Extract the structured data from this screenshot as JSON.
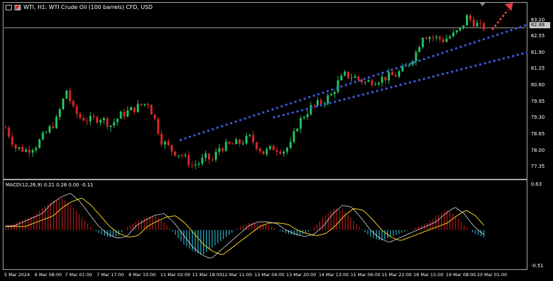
{
  "chart": {
    "title": "WTI, H1:  WTI Crude Oil (100 barrels) CFD, USD",
    "current_price": "82.88",
    "y_ticks": [
      "83.20",
      "82.55",
      "81.90",
      "81.25",
      "80.60",
      "79.95",
      "79.30",
      "78.65",
      "78.00",
      "77.35"
    ],
    "x_ticks": [
      "5 Mar 2024",
      "6 Mar 08:00",
      "7 Mar 01:00",
      "7 Mar 17:00",
      "8 Mar 10:00",
      "11 Mar 02:00",
      "11 Mar 18:00",
      "12 Mar 11:00",
      "13 Mar 04:00",
      "13 Mar 20:00",
      "14 Mar 13:00",
      "15 Mar 06:00",
      "15 Mar 22:00",
      "18 Mar 15:00",
      "19 Mar 08:00",
      "20 Mar 01:00"
    ]
  },
  "indicator": {
    "title": "MACD(12,26,9) 0.21 0.26 0.00 -0.11",
    "y_ticks": [
      "0.63",
      "-0.51"
    ]
  },
  "colors": {
    "background": "#000000",
    "bull": "#22c55e",
    "bear": "#dc2626",
    "trendline": "#3b5bdb",
    "arrow": "#e23b4a",
    "macd_pos": "#b91c1c",
    "macd_neg": "#22b8cf",
    "signal": "#f5d020",
    "macd_line": "#ffffff"
  },
  "chart_data": {
    "type": "candlestick",
    "symbol": "WTI",
    "timeframe": "H1",
    "ylim": [
      77.0,
      83.6
    ],
    "close_path": [
      [
        0,
        78.9
      ],
      [
        3,
        78.1
      ],
      [
        6,
        78.0
      ],
      [
        9,
        78.2
      ],
      [
        12,
        78.7
      ],
      [
        15,
        79.2
      ],
      [
        18,
        80.4
      ],
      [
        20,
        79.6
      ],
      [
        22,
        79.3
      ],
      [
        25,
        79.2
      ],
      [
        28,
        79.3
      ],
      [
        31,
        79.0
      ],
      [
        34,
        79.4
      ],
      [
        37,
        79.6
      ],
      [
        40,
        79.8
      ],
      [
        42,
        79.9
      ],
      [
        44,
        79.2
      ],
      [
        46,
        78.4
      ],
      [
        49,
        78.0
      ],
      [
        52,
        77.8
      ],
      [
        55,
        77.4
      ],
      [
        57,
        77.5
      ],
      [
        59,
        77.7
      ],
      [
        61,
        77.6
      ],
      [
        63,
        78.1
      ],
      [
        66,
        78.2
      ],
      [
        69,
        78.3
      ],
      [
        72,
        78.5
      ],
      [
        74,
        78.2
      ],
      [
        76,
        77.9
      ],
      [
        79,
        78.1
      ],
      [
        82,
        78.0
      ],
      [
        84,
        78.2
      ],
      [
        86,
        79.0
      ],
      [
        88,
        79.4
      ],
      [
        90,
        79.7
      ],
      [
        93,
        79.9
      ],
      [
        96,
        80.2
      ],
      [
        98,
        80.7
      ],
      [
        100,
        81.0
      ],
      [
        103,
        80.9
      ],
      [
        106,
        80.7
      ],
      [
        109,
        80.8
      ],
      [
        112,
        80.9
      ],
      [
        115,
        81.0
      ],
      [
        118,
        81.3
      ],
      [
        121,
        81.9
      ],
      [
        123,
        82.6
      ],
      [
        126,
        82.5
      ],
      [
        129,
        82.4
      ],
      [
        132,
        82.6
      ],
      [
        134,
        82.8
      ],
      [
        136,
        83.3
      ],
      [
        138,
        83.1
      ],
      [
        140,
        82.9
      ],
      [
        141,
        82.9
      ]
    ],
    "macd_hist": [
      0.05,
      0.1,
      0.15,
      0.2,
      0.32,
      0.4,
      0.45,
      0.35,
      0.2,
      0.05,
      -0.05,
      -0.1,
      -0.08,
      0.05,
      0.12,
      0.18,
      0.2,
      0.1,
      -0.05,
      -0.2,
      -0.3,
      -0.35,
      -0.25,
      -0.15,
      -0.05,
      0.05,
      0.1,
      0.1,
      0.08,
      0.0,
      -0.05,
      -0.08,
      -0.05,
      0.05,
      0.2,
      0.3,
      0.28,
      0.15,
      0.0,
      -0.1,
      -0.15,
      -0.1,
      -0.05,
      0.0,
      0.05,
      0.1,
      0.2,
      0.28,
      0.2,
      0.05,
      -0.05,
      -0.1
    ]
  },
  "annotations": {
    "trendline_1": {
      "from": [
        "11 Mar 02:00",
        78.4
      ],
      "to": [
        "20 Mar 07:00",
        83.0
      ]
    },
    "trendline_2": {
      "from": [
        "13 Mar 04:00",
        79.3
      ],
      "to": [
        "20 Mar 07:00",
        81.9
      ]
    },
    "arrow": {
      "direction": "up-right"
    }
  }
}
